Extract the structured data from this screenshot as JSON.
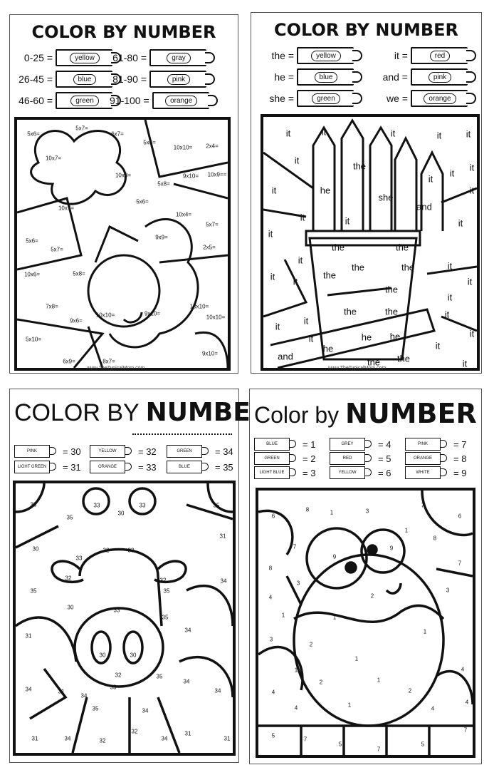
{
  "watermark": "www.TheTypicalMom.com",
  "panel1": {
    "title": "COLOR BY NUMBER",
    "legend": [
      {
        "key": "0-25 =",
        "color": "yellow"
      },
      {
        "key": "26-45 =",
        "color": "blue"
      },
      {
        "key": "46-60 =",
        "color": "green"
      },
      {
        "key": "61-80 =",
        "color": "gray"
      },
      {
        "key": "81-90 =",
        "color": "pink"
      },
      {
        "key": "91-100 =",
        "color": "orange"
      }
    ],
    "labels": [
      "5x6=",
      "5x7=",
      "6x7=",
      "10x7=",
      "5x6=",
      "10x10=",
      "2x4=",
      "10x8=",
      "5x8=",
      "9x10=",
      "10x9==",
      "10x7=",
      "5x6=",
      "10x4=",
      "5x7=",
      "5x6=",
      "5x7=",
      "9x9=",
      "2x5=",
      "10x6=",
      "5x8=",
      "7x8=",
      "9x6=",
      "10x10=",
      "9x10=",
      "10x10=",
      "10x10=",
      "5x10=",
      "6x9=",
      "8x7=",
      "9x10="
    ]
  },
  "panel2": {
    "title": "COLOR BY NUMBER",
    "legend": [
      {
        "key": "the =",
        "color": "yellow"
      },
      {
        "key": "he =",
        "color": "blue"
      },
      {
        "key": "she =",
        "color": "green"
      },
      {
        "key": "it =",
        "color": "red"
      },
      {
        "key": "and =",
        "color": "pink"
      },
      {
        "key": "we =",
        "color": "orange"
      }
    ],
    "labels": [
      "it",
      "it",
      "it",
      "it",
      "it",
      "it",
      "it",
      "it",
      "it",
      "he",
      "the",
      "she",
      "it",
      "it",
      "it",
      "it",
      "and",
      "it",
      "it",
      "the",
      "the",
      "it",
      "the",
      "the",
      "the",
      "it",
      "it",
      "it",
      "it",
      "the",
      "it",
      "it",
      "it",
      "the",
      "the",
      "it",
      "it",
      "it",
      "he",
      "he",
      "it",
      "he",
      "the",
      "the",
      "it",
      "and"
    ]
  },
  "panel3": {
    "title_a": "COLOR BY",
    "title_b": "NUMBER",
    "legend": [
      {
        "color": "PINK",
        "value": "= 30"
      },
      {
        "color": "LIGHT GREEN",
        "value": "= 31"
      },
      {
        "color": "YELLOW",
        "value": "= 32"
      },
      {
        "color": "ORANGE",
        "value": "= 33"
      },
      {
        "color": "GREEN",
        "value": "= 34"
      },
      {
        "color": "BLUE",
        "value": "= 35"
      }
    ],
    "labels": [
      "35",
      "33",
      "30",
      "33",
      "35",
      "35",
      "30",
      "33",
      "32",
      "33",
      "31",
      "32",
      "32",
      "35",
      "30",
      "33",
      "35",
      "35",
      "34",
      "31",
      "34",
      "30",
      "30",
      "32",
      "35",
      "34",
      "31",
      "34",
      "33",
      "34",
      "34",
      "35",
      "34",
      "32",
      "31",
      "34",
      "32",
      "34",
      "31",
      "31"
    ]
  },
  "panel4": {
    "title_a": "Color by",
    "title_b": "NUMBER",
    "legend": [
      {
        "color": "BLUE",
        "value": "= 1"
      },
      {
        "color": "GREEN",
        "value": "= 2"
      },
      {
        "color": "LIGHT BLUE",
        "value": "= 3"
      },
      {
        "color": "GREY",
        "value": "= 4"
      },
      {
        "color": "RED",
        "value": "= 5"
      },
      {
        "color": "YELLOW",
        "value": "= 6"
      },
      {
        "color": "PINK",
        "value": "= 7"
      },
      {
        "color": "ORANGE",
        "value": "= 8"
      },
      {
        "color": "WHITE",
        "value": "= 9"
      }
    ],
    "labels": [
      "6",
      "8",
      "1",
      "3",
      "7",
      "6",
      "7",
      "8",
      "1",
      "9",
      "9",
      "8",
      "7",
      "2",
      "3",
      "3",
      "1",
      "1",
      "4",
      "1",
      "3",
      "2",
      "1",
      "4",
      "1",
      "2",
      "1",
      "2",
      "4",
      "4",
      "1",
      "4",
      "4",
      "5",
      "7",
      "5",
      "7",
      "5",
      "7"
    ]
  }
}
